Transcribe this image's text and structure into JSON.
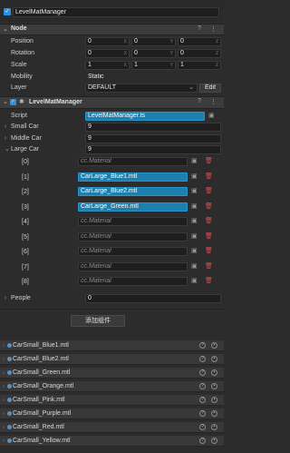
{
  "node_name": "LevelMatManager",
  "node_section": {
    "title": "Node"
  },
  "props": {
    "position": {
      "label": "Position",
      "x": "0",
      "y": "0",
      "z": "0"
    },
    "rotation": {
      "label": "Rotation",
      "x": "0",
      "y": "0",
      "z": "0"
    },
    "scale": {
      "label": "Scale",
      "x": "1",
      "y": "1",
      "z": "1"
    },
    "mobility": {
      "label": "Mobility",
      "value": "Static"
    },
    "layer": {
      "label": "Layer",
      "value": "DEFAULT",
      "edit_label": "Edit"
    }
  },
  "axis_labels": {
    "x": "X",
    "y": "Y",
    "z": "Z"
  },
  "component": {
    "title": "LevelMatManager",
    "script_label": "Script",
    "script_value": "LevelMatManager.ts",
    "small_car": {
      "label": "Small Car",
      "value": "9"
    },
    "middle_car": {
      "label": "Middle Car",
      "value": "9"
    },
    "large_car": {
      "label": "Large Car",
      "value": "9"
    },
    "items": [
      {
        "index": "[0]",
        "value": "cc.Material"
      },
      {
        "index": "[1]",
        "value": "CarLarge_Blue1.mtl"
      },
      {
        "index": "[2]",
        "value": "CarLarge_Blue2.mtl"
      },
      {
        "index": "[3]",
        "value": "CarLarge_Green.mtl"
      },
      {
        "index": "[4]",
        "value": "cc.Material"
      },
      {
        "index": "[5]",
        "value": "cc.Material"
      },
      {
        "index": "[6]",
        "value": "cc.Material"
      },
      {
        "index": "[7]",
        "value": "cc.Material"
      },
      {
        "index": "[8]",
        "value": "cc.Material"
      }
    ],
    "people": {
      "label": "People",
      "value": "0"
    }
  },
  "add_component_label": "添加组件",
  "assets": [
    "CarSmall_Blue1.mtl",
    "CarSmall_Blue2.mtl",
    "CarSmall_Green.mtl",
    "CarSmall_Orange.mtl",
    "CarSmall_Pink.mtl",
    "CarSmall_Purple.mtl",
    "CarSmall_Red.mtl",
    "CarSmall_Yellow.mtl"
  ],
  "colors": {
    "accent_blue": "#1d7fae",
    "delete_red": "#d45050",
    "checkbox_blue": "#2d8fe0"
  }
}
